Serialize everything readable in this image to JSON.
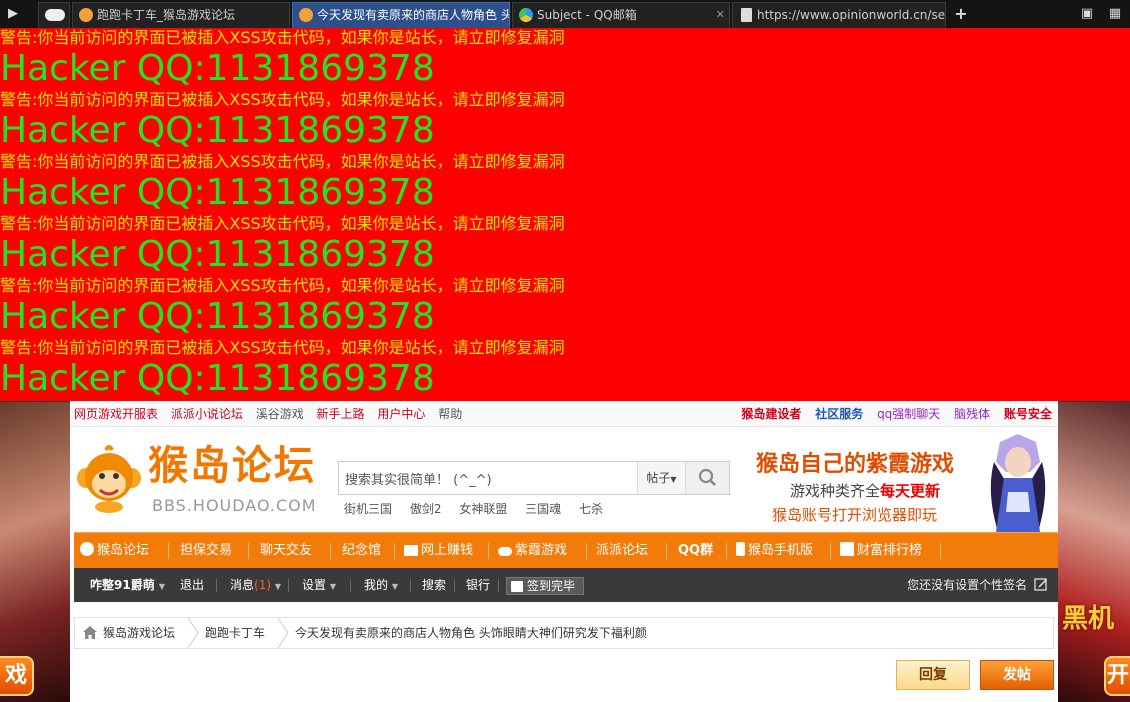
{
  "browser": {
    "tabs": [
      {
        "title": ""
      },
      {
        "title": "跑跑卡丁车_猴岛游戏论坛"
      },
      {
        "title": "今天发现有卖原来的商店人物角色 头饰眼睛大神们研究发下福利颜"
      },
      {
        "title": "Subject - QQ邮箱"
      },
      {
        "title": "https://www.opinionworld.cn/secured/"
      }
    ],
    "new_tab_label": "+"
  },
  "xss_banner": {
    "warning": "警告:你当前访问的界面已被插入XSS攻击代码，如果你是站长，请立即修复漏洞",
    "hacker": "Hacker QQ:1131869378"
  },
  "forum": {
    "top_links_left": [
      "网页游戏开服表",
      "派派小说论坛",
      "溪谷游戏",
      "新手上路",
      "用户中心",
      "帮助"
    ],
    "top_links_right": [
      "猴岛建设者",
      "社区服务",
      "qq强制聊天",
      "脑残体",
      "账号安全"
    ],
    "logo": {
      "title": "猴岛论坛",
      "subtitle": "BBS.HOUDAO.COM"
    },
    "search": {
      "value": "搜索其实很简单！ (^_^)",
      "category": "帖子"
    },
    "hot_searches": [
      "街机三国",
      "傲剑2",
      "女神联盟",
      "三国魂",
      "七杀"
    ],
    "ad": {
      "line1": "猴岛自己的紫霞游戏",
      "line2a": "游戏种类齐全",
      "line2b": "每天更新",
      "line3": "猴岛账号打开浏览器即玩"
    },
    "main_nav": [
      "猴岛论坛",
      "担保交易",
      "聊天交友",
      "纪念馆",
      "网上赚钱",
      "紫霞游戏",
      "派派论坛",
      "QQ群",
      "猴岛手机版",
      "财富排行榜"
    ],
    "user_nav": {
      "username": "咋整91爵萌",
      "logout": "退出",
      "messages": "消息",
      "message_count": "(1)",
      "settings": "设置",
      "mine": "我的",
      "search": "搜索",
      "bank": "银行",
      "checkin": "签到完毕",
      "signature": "您还没有设置个性签名"
    },
    "breadcrumbs": [
      "猴岛游戏论坛",
      "跑跑卡丁车",
      "今天发现有卖原来的商店人物角色 头饰眼睛大神们研究发下福利颜"
    ],
    "buttons": {
      "reply": "回复",
      "post": "发帖"
    }
  },
  "side_ads": {
    "left_btn": "戏",
    "right_btn": "开",
    "right_logo": "黑机"
  }
}
